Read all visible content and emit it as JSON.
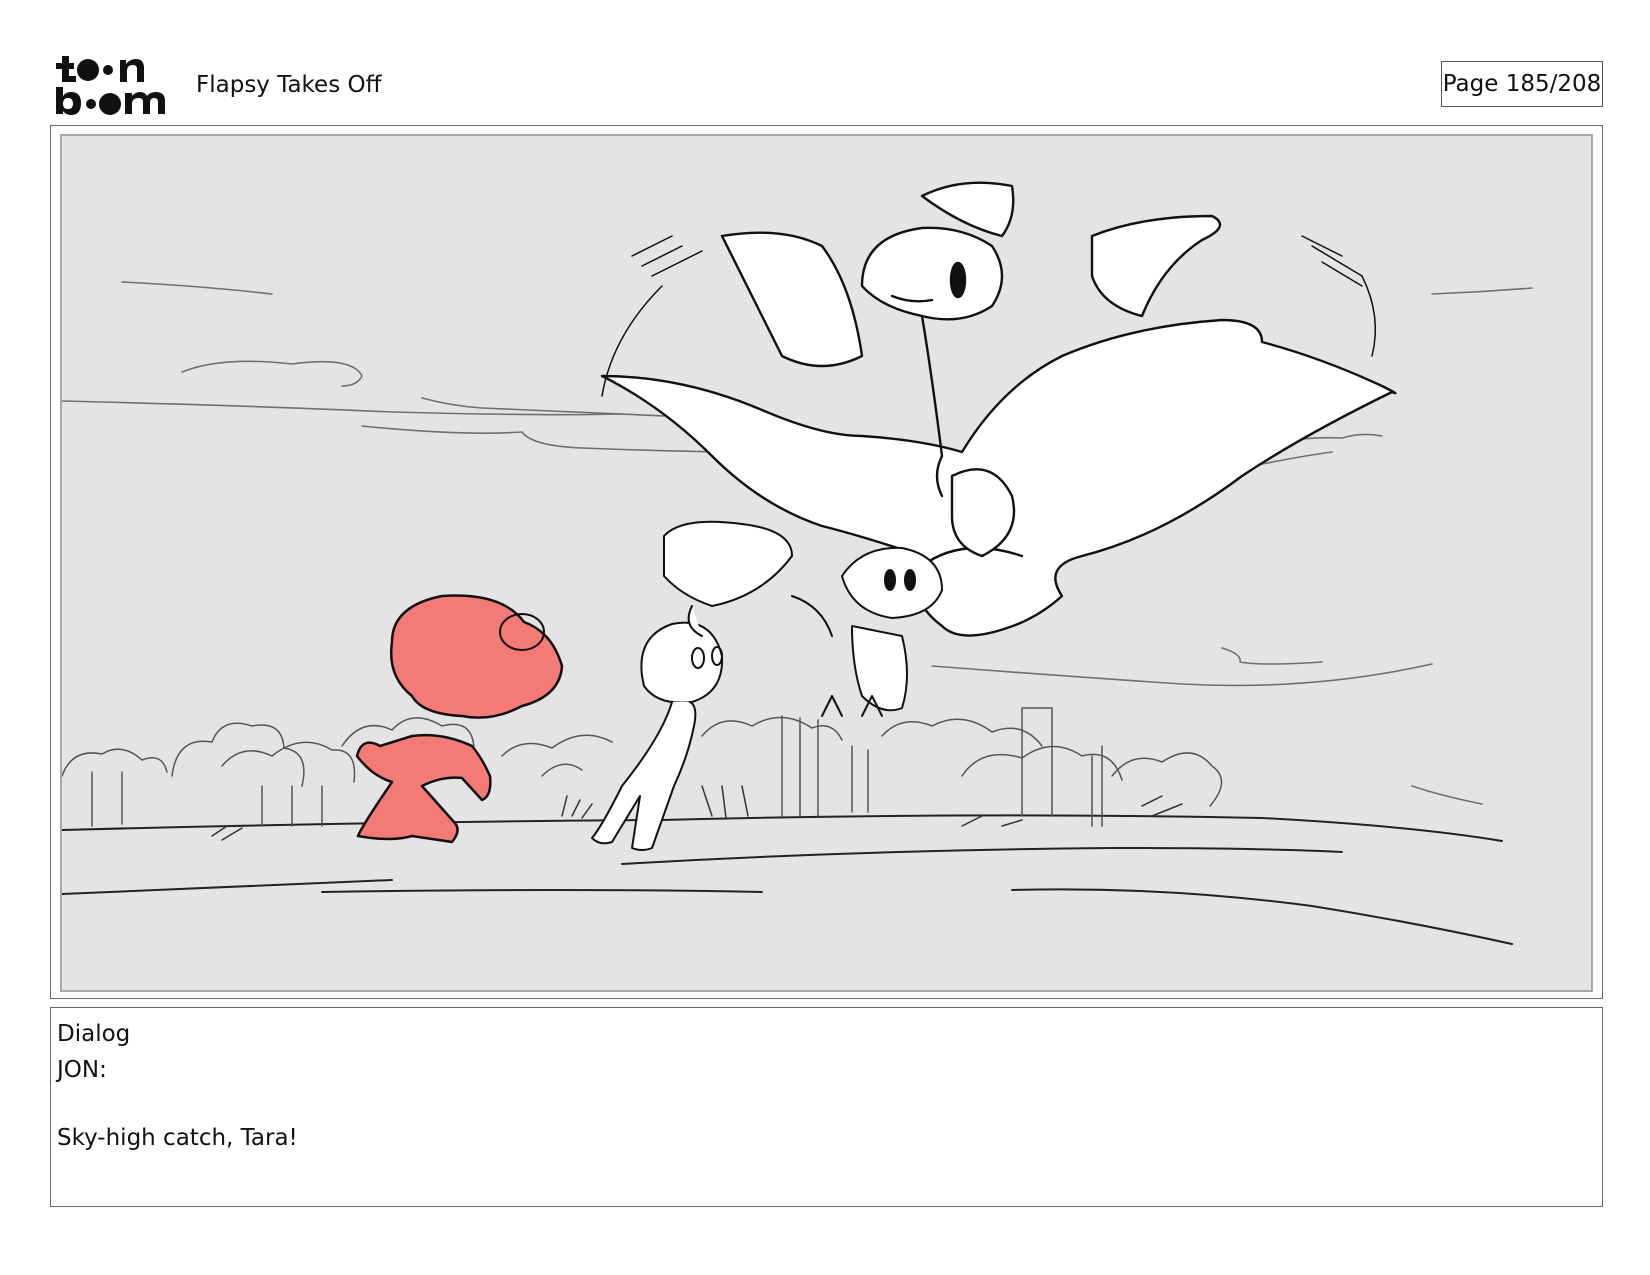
{
  "header": {
    "logo": {
      "icon": "toon-boom-logo",
      "line1": "toon",
      "line2": "boom"
    },
    "project_title": "Flapsy Takes Off",
    "page_counter": "Page 185/208"
  },
  "panel": {
    "image": "storyboard-sketch",
    "colors": {
      "background": "#e4e4e4",
      "highlight_character": "#f47a76",
      "line": "#111111",
      "frame": "#a8a8a8"
    }
  },
  "dialog": {
    "heading": "Dialog",
    "speaker": "JON:",
    "line": "Sky-high catch, Tara!"
  }
}
